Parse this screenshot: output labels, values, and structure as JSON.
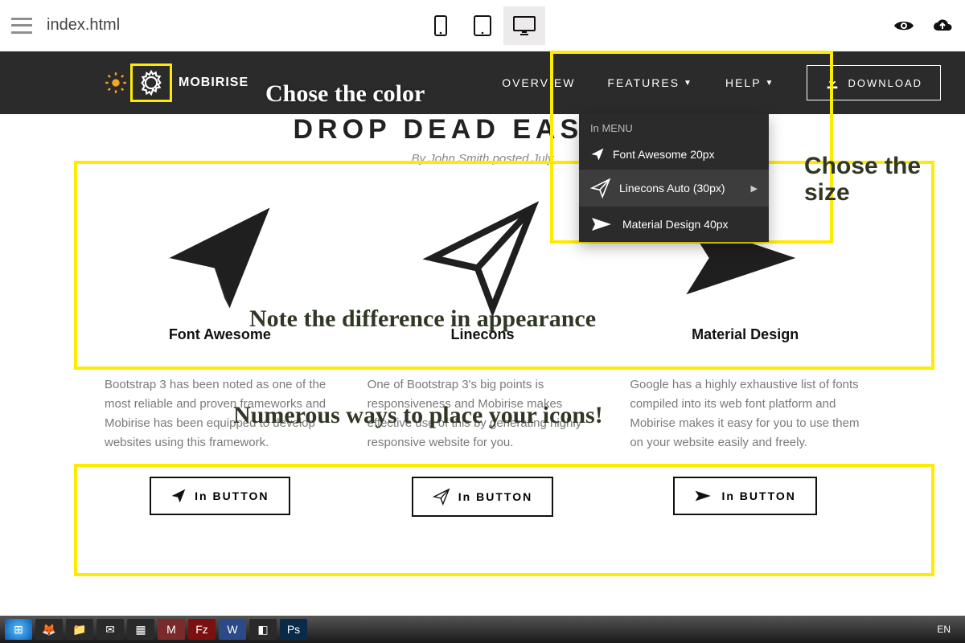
{
  "topbar": {
    "filename": "index.html"
  },
  "nav": {
    "brand": "MOBIRISE",
    "overview": "OVERVIEW",
    "features": "FEATURES",
    "help": "HELP",
    "download": "DOWNLOAD"
  },
  "dropdown": {
    "header": "In MENU",
    "items": [
      {
        "label": "Font Awesome 20px"
      },
      {
        "label": "Linecons Auto (30px)"
      },
      {
        "label": "Material Design 40px"
      }
    ]
  },
  "page": {
    "title": "DROP DEAD EASY WE",
    "byline": "By John Smith posted July"
  },
  "columns": [
    {
      "name": "Font Awesome",
      "desc": "Bootstrap 3 has been noted as one of the most reliable and proven frameworks and Mobirise has been equipped to develop websites using this framework.",
      "button": "In BUTTON"
    },
    {
      "name": "Linecons",
      "desc": "One of Bootstrap 3's big points is responsiveness and Mobirise makes effective use of this by generating highly responsive website for you.",
      "button": "In BUTTON"
    },
    {
      "name": "Material Design",
      "desc": "Google has a highly exhaustive list of fonts compiled into its web font platform and Mobirise makes it easy for you to use them on your website easily and freely.",
      "button": "In BUTTON"
    }
  ],
  "annotations": {
    "color": "Chose the color",
    "size": "Chose the size",
    "diff": "Note the difference in appearance",
    "ways": "Numerous ways to place your icons!"
  },
  "taskbar": {
    "lang": "EN"
  }
}
